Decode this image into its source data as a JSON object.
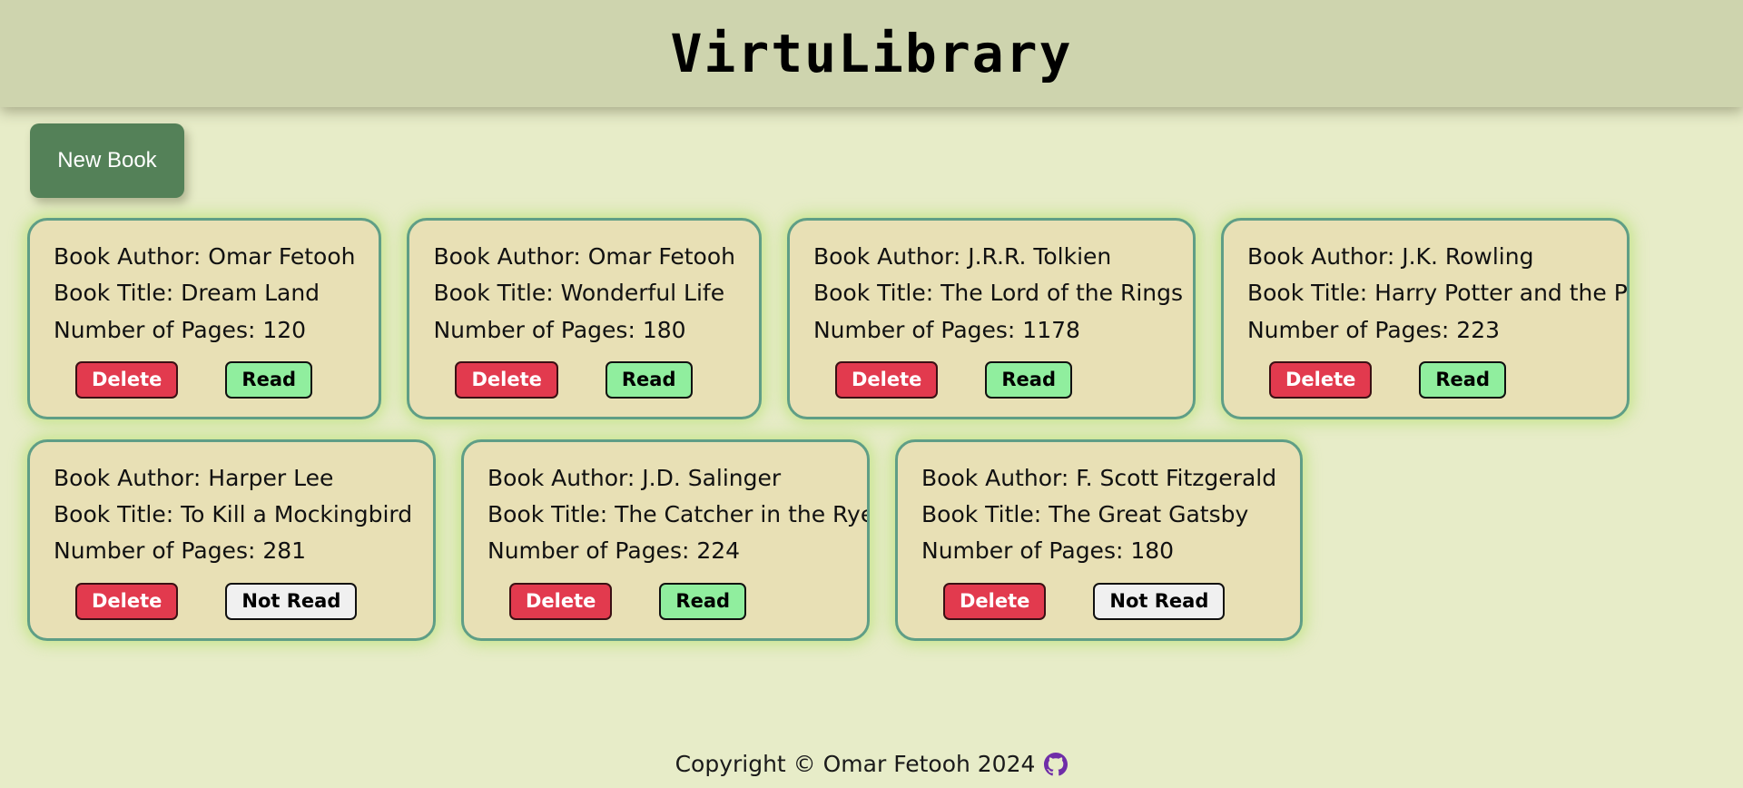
{
  "header": {
    "title": "VirtuLibrary",
    "background_color": "#ced4ae"
  },
  "toolbar": {
    "new_book_label": "New Book",
    "new_book_color": "#548158"
  },
  "labels": {
    "author_prefix": "Book Author: ",
    "title_prefix": "Book Title: ",
    "pages_prefix": "Number of Pages: ",
    "delete_label": "Delete",
    "read_label": "Read",
    "not_read_label": "Not Read"
  },
  "colors": {
    "page_background": "#e7ecc8",
    "card_background": "#e8e0b5",
    "card_border": "#5f9e86",
    "delete_red": "#e23a4e",
    "read_green": "#90ee9e",
    "not_read_gray": "#f0f0f0",
    "github_purple": "#6f2da8"
  },
  "books": [
    {
      "author_line": "Book Author: Omar Fetooh",
      "title_line": "Book Title: Dream Land",
      "pages_line": "Number of Pages: 120",
      "author": "Omar Fetooh",
      "title": "Dream Land",
      "pages": 120,
      "delete_label": "Delete",
      "status_label": "Read",
      "status": "read"
    },
    {
      "author_line": "Book Author: Omar Fetooh",
      "title_line": "Book Title: Wonderful Life",
      "pages_line": "Number of Pages: 180",
      "author": "Omar Fetooh",
      "title": "Wonderful Life",
      "pages": 180,
      "delete_label": "Delete",
      "status_label": "Read",
      "status": "read"
    },
    {
      "author_line": "Book Author: J.R.R. Tolkien",
      "title_line": "Book Title: The Lord of the Rings",
      "pages_line": "Number of Pages: 1178",
      "author": "J.R.R. Tolkien",
      "title": "The Lord of the Rings",
      "pages": 1178,
      "delete_label": "Delete",
      "status_label": "Read",
      "status": "read"
    },
    {
      "author_line": "Book Author: J.K. Rowling",
      "title_line": "Book Title: Harry Potter and the Phil",
      "pages_line": "Number of Pages: 223",
      "author": "J.K. Rowling",
      "title": "Harry Potter and the Phil",
      "pages": 223,
      "delete_label": "Delete",
      "status_label": "Read",
      "status": "read"
    },
    {
      "author_line": "Book Author: Harper Lee",
      "title_line": "Book Title: To Kill a Mockingbird",
      "pages_line": "Number of Pages: 281",
      "author": "Harper Lee",
      "title": "To Kill a Mockingbird",
      "pages": 281,
      "delete_label": "Delete",
      "status_label": "Not Read",
      "status": "not-read"
    },
    {
      "author_line": "Book Author: J.D. Salinger",
      "title_line": "Book Title: The Catcher in the Rye",
      "pages_line": "Number of Pages: 224",
      "author": "J.D. Salinger",
      "title": "The Catcher in the Rye",
      "pages": 224,
      "delete_label": "Delete",
      "status_label": "Read",
      "status": "read"
    },
    {
      "author_line": "Book Author: F. Scott Fitzgerald",
      "title_line": "Book Title: The Great Gatsby",
      "pages_line": "Number of Pages: 180",
      "author": "F. Scott Fitzgerald",
      "title": "The Great Gatsby",
      "pages": 180,
      "delete_label": "Delete",
      "status_label": "Not Read",
      "status": "not-read"
    }
  ],
  "footer": {
    "text": "Copyright © Omar Fetooh 2024",
    "github_icon": "github-icon"
  }
}
